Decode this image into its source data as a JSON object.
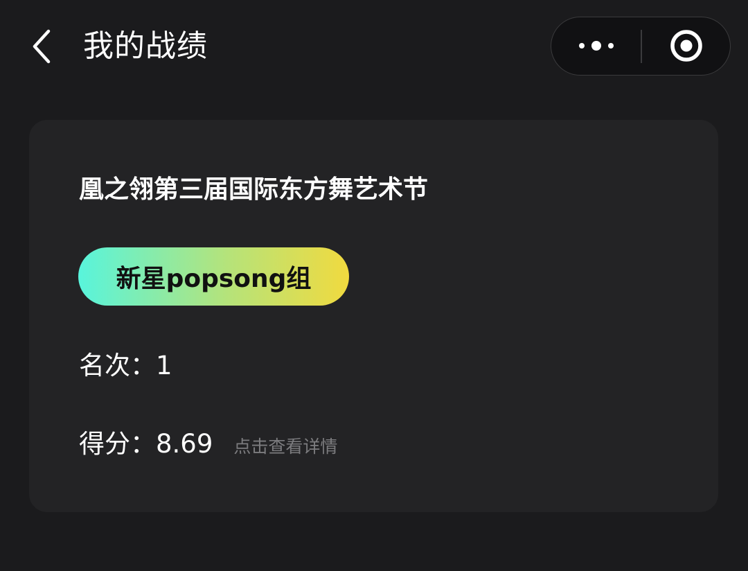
{
  "navbar": {
    "back_icon": "chevron-left-icon",
    "title": "我的战绩",
    "capsule": {
      "more_icon": "more-dots-icon",
      "close_icon": "target-circle-icon",
      "background": "#111113",
      "border": "#3b3b3d"
    }
  },
  "record": {
    "event_title": "凰之翎第三届国际东方舞艺术节",
    "group": "新星popsong组",
    "rank_label": "名次：",
    "rank_value": "1",
    "score_label": "得分：",
    "score_value": "8.69",
    "detail_link": "点击查看详情"
  },
  "colors": {
    "page_background": "#1b1b1d",
    "card_background": "#232325",
    "tag_gradient_start": "#58f4dc",
    "tag_gradient_end": "#f1da3f",
    "muted_text": "#7c7c7f"
  }
}
